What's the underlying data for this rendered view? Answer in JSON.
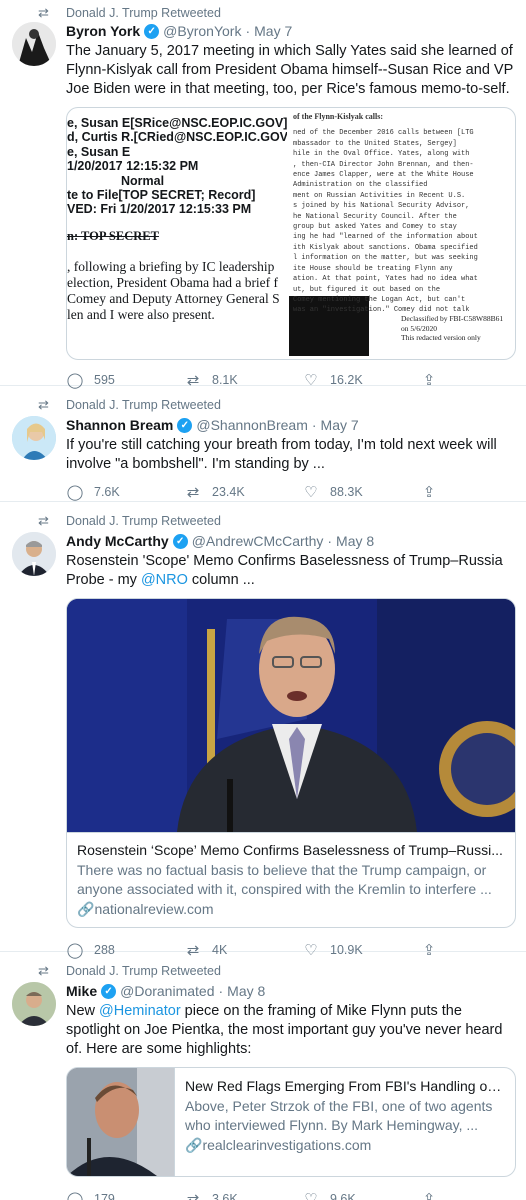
{
  "retweet_label": "Donald J. Trump Retweeted",
  "tweets": [
    {
      "name": "Byron York",
      "handle": "@ByronYork",
      "date": "May 7",
      "text": "The January 5, 2017 meeting in which Sally Yates said she learned of Flynn-Kislyak call from President Obama himself--Susan Rice and VP Joe Biden were in that meeting, too, per Rice's famous memo-to-self.",
      "replies": "595",
      "retweets": "8.1K",
      "likes": "16.2K",
      "doc_left_lines": [
        "e, Susan E[SRice@NSC.EOP.IC.GOV]",
        "d, Curtis R.[CRied@NSC.EOP.IC.GOV]",
        "e, Susan E",
        "1/20/2017 12:15:32 PM",
        "Normal",
        "te to File[TOP SECRET; Record]",
        "VED:   Fri 1/20/2017 12:15:33 PM",
        "n: TOP SECRET",
        ", following a briefing by IC leadership",
        "election, President Obama had a brief f",
        "Comey and Deputy Attorney General S",
        "len and I were also present."
      ],
      "doc_right_title": "of the Flynn-Kislyak calls:",
      "doc_right_lines": [
        "ned of the December 2016 calls between [LTG",
        "mbassador to the United States, Sergey]",
        "hile in the Oval Office.  Yates, along with",
        ", then-CIA Director John Brennan, and then-",
        "ence James Clapper, were at the White House",
        " Administration on the classified",
        "ment on Russian Activities in Recent U.S.",
        "s joined by his National Security Advisor,",
        "he National Security Council.  After the",
        " group but asked Yates and Comey to stay",
        "ing he had \"learned of the information about",
        "ith Kislyak about sanctions.  Obama specified",
        "l information on the matter, but was seeking",
        "ite House should be treating Flynn any",
        "ation.  At that point, Yates had no idea what",
        "ut, but figured it out based on the",
        " Comey mentioning the Logan Act, but can't",
        "was an \"investigation.\" Comey did not talk"
      ],
      "doc_declass": [
        "Declassified by FBI-C58W88B61",
        "on 5/6/2020",
        "This redacted version only"
      ]
    },
    {
      "name": "Shannon Bream",
      "handle": "@ShannonBream",
      "date": "May 7",
      "text": "If you're still catching your breath from today, I'm told next week will involve \"a bombshell\".  I'm standing by ...",
      "replies": "7.6K",
      "retweets": "23.4K",
      "likes": "88.3K"
    },
    {
      "name": "Andy McCarthy",
      "handle": "@AndrewCMcCarthy",
      "date": "May 8",
      "text_pre": "Rosenstein 'Scope' Memo Confirms Baselessness of Trump–Russia Probe - my ",
      "text_link": "@NRO",
      "text_post": " column ...",
      "card_title": "Rosenstein ‘Scope’ Memo Confirms Baselessness of Trump–Russi...",
      "card_desc": "There was no factual basis to believe that the Trump campaign, or anyone associated with it, conspired with the Kremlin to interfere ...",
      "card_url": "nationalreview.com",
      "replies": "288",
      "retweets": "4K",
      "likes": "10.9K"
    },
    {
      "name": "Mike",
      "handle": "@Doranimated",
      "date": "May 8",
      "text_pre": "New ",
      "text_link": "@Heminator",
      "text_post": " piece on the framing of Mike Flynn  puts the spotlight on Joe Pientka, the most important guy you've never heard of.  Here are some highlights:",
      "card_title": "New Red Flags Emerging From FBI's Handling of ...",
      "card_desc": "Above, Peter Strzok of the FBI, one of two agents who interviewed Flynn. By Mark Hemingway, ...",
      "card_url": "realclearinvestigations.com",
      "replies": "179",
      "retweets": "3.6K",
      "likes": "9.6K"
    }
  ]
}
